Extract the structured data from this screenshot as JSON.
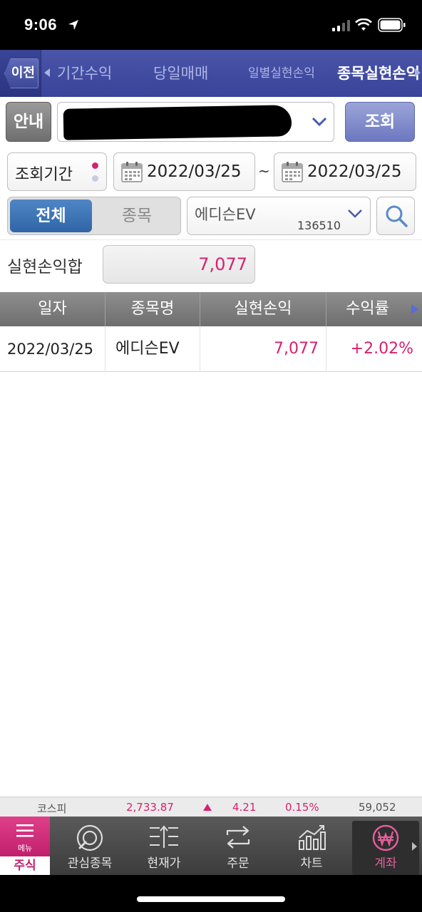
{
  "status_bar": {
    "time": "9:06"
  },
  "tab_nav": {
    "back_label": "이전",
    "tabs": [
      {
        "label": "기간수익",
        "active": false
      },
      {
        "label": "당일매매",
        "active": false
      },
      {
        "label": "일별실현손익",
        "active": false
      },
      {
        "label": "종목실현손익",
        "active": true
      }
    ]
  },
  "account": {
    "info_button": "안내",
    "query_button": "조회"
  },
  "period": {
    "label": "조회기간",
    "start_date": "2022/03/25",
    "separator": "~",
    "end_date": "2022/03/25"
  },
  "filter": {
    "all_label": "전체",
    "stock_label": "종목",
    "stock_name": "에디슨EV",
    "stock_code": "136510"
  },
  "summary": {
    "label": "실현손익합",
    "value": "7,077"
  },
  "table": {
    "headers": [
      "일자",
      "종목명",
      "실현손익",
      "수익률"
    ],
    "rows": [
      {
        "date": "2022/03/25",
        "name": "에디슨EV",
        "pnl": "7,077",
        "rate": "+2.02%"
      }
    ]
  },
  "ticker": {
    "index_name": "코스피",
    "index_value": "2,733.87",
    "change": "4.21",
    "change_pct": "0.15%",
    "volume": "59,052"
  },
  "bottom_nav": {
    "menu_small": "메뉴",
    "menu_label": "주식",
    "items": [
      "관심종목",
      "현재가",
      "주문",
      "차트",
      "계좌"
    ]
  },
  "colors": {
    "nav_blue": "#39449a",
    "positive_pink": "#d4226f",
    "active_segment": "#2f65a6"
  }
}
